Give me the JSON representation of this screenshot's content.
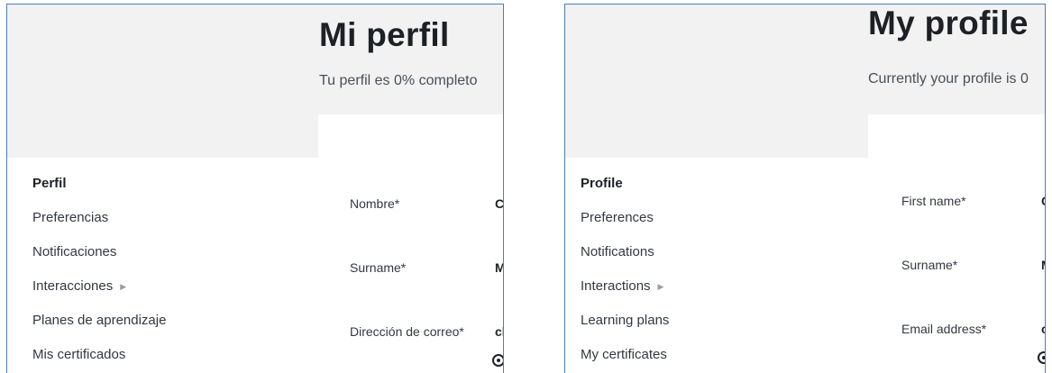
{
  "spanish": {
    "title": "Mi perfil",
    "completion": "Tu perfil es 0% completo",
    "nav": [
      {
        "label": "Perfil",
        "active": true
      },
      {
        "label": "Preferencias"
      },
      {
        "label": "Notificaciones"
      },
      {
        "label": "Interacciones",
        "submenu_icon": "caret-right-icon"
      },
      {
        "label": "Planes de aprendizaje"
      },
      {
        "label": "Mis certificados"
      }
    ],
    "fields": [
      {
        "label": "Nombre*",
        "value": "Cl"
      },
      {
        "label": "Surname*",
        "value": "M"
      },
      {
        "label": "Dirección de correo*",
        "value": "cl"
      }
    ]
  },
  "english": {
    "title": "My profile",
    "completion": "Currently your profile is 0",
    "nav": [
      {
        "label": "Profile",
        "active": true
      },
      {
        "label": "Preferences"
      },
      {
        "label": "Notifications"
      },
      {
        "label": "Interactions",
        "submenu_icon": "caret-right-icon"
      },
      {
        "label": "Learning plans"
      },
      {
        "label": "My certificates"
      }
    ],
    "fields": [
      {
        "label": "First name*",
        "value": "C"
      },
      {
        "label": "Surname*",
        "value": "M"
      },
      {
        "label": "Email address*",
        "value": "c"
      }
    ]
  },
  "colors": {
    "header_bg": "#f2f2f2",
    "frame_border": "#4a7ebb",
    "text": "#1d2125"
  }
}
